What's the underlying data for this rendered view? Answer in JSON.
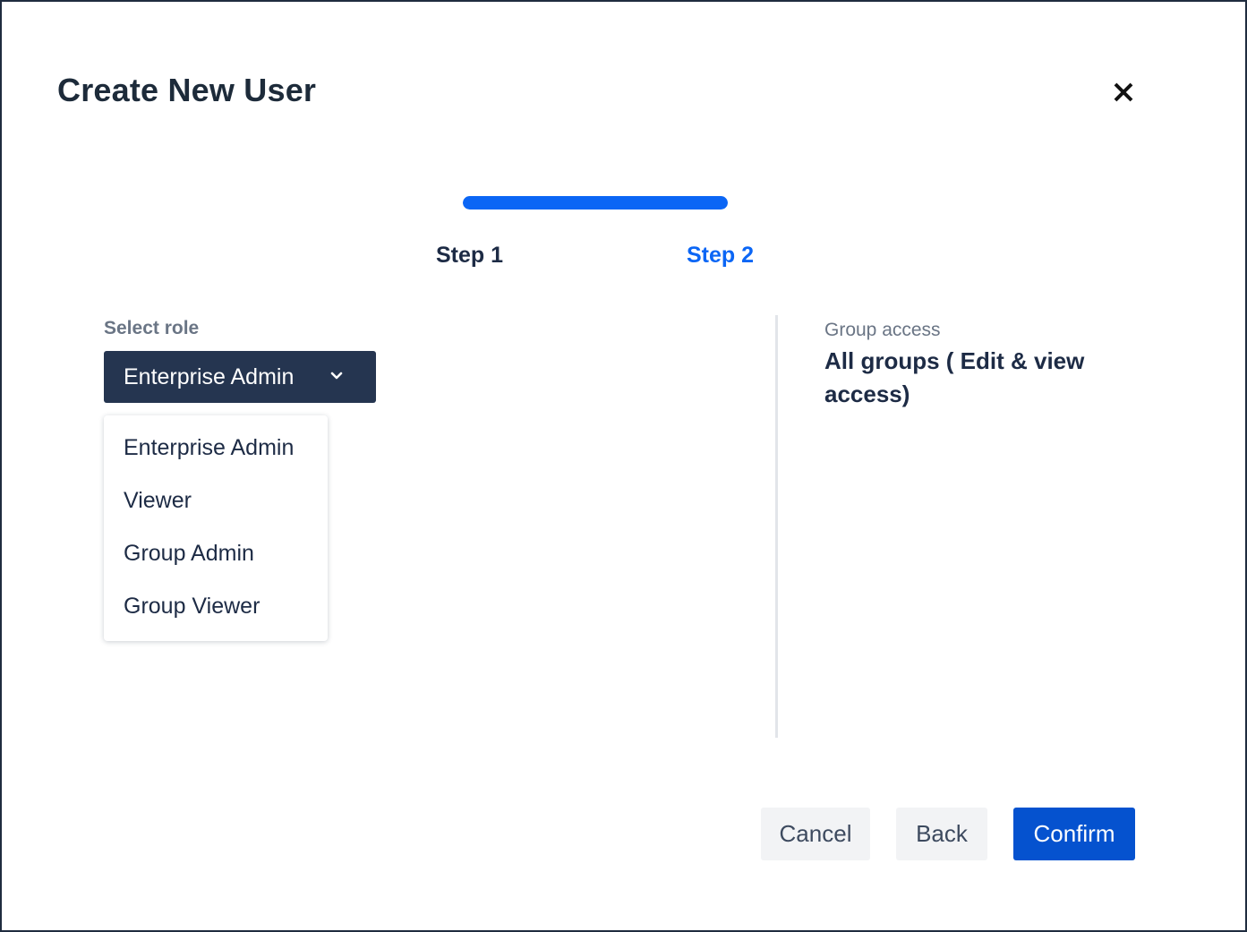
{
  "dialog": {
    "title": "Create New User",
    "close_icon": "close-icon"
  },
  "progress": {
    "fraction": 1.0,
    "accent_color": "#0b66f5"
  },
  "steps": [
    {
      "label": "Step 1",
      "state": "completed"
    },
    {
      "label": "Step 2",
      "state": "active"
    }
  ],
  "role": {
    "label": "Select role",
    "selected": "Enterprise Admin",
    "dropdown_icon": "chevron-down-icon",
    "options": [
      "Enterprise Admin",
      "Viewer",
      "Group Admin",
      "Group Viewer"
    ]
  },
  "access": {
    "label": "Group access",
    "value": "All groups ( Edit & view access)"
  },
  "buttons": {
    "cancel": "Cancel",
    "back": "Back",
    "confirm": "Confirm"
  },
  "colors": {
    "primary": "#0552cf",
    "select_bg": "#253550"
  }
}
